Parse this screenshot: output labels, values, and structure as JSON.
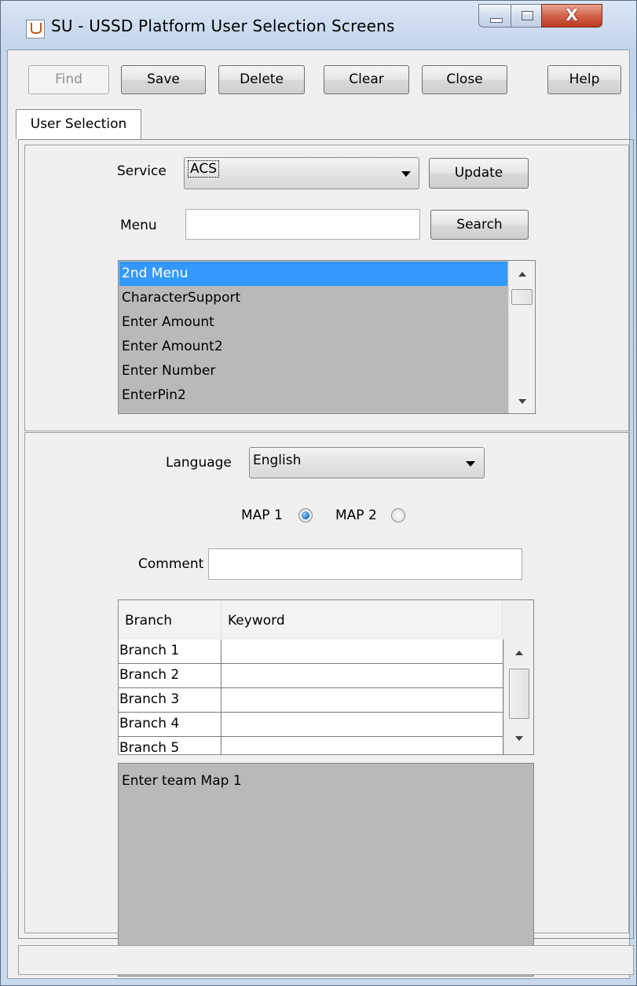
{
  "window": {
    "title": "SU - USSD Platform User Selection Screens",
    "close_glyph": "X"
  },
  "toolbar": {
    "find_label": "Find",
    "save_label": "Save",
    "delete_label": "Delete",
    "clear_label": "Clear",
    "close_label": "Close",
    "help_label": "Help"
  },
  "tabs": [
    {
      "label": "User Selection",
      "active": true
    }
  ],
  "service": {
    "label": "Service",
    "selected": "ACS",
    "update_label": "Update"
  },
  "menu": {
    "label": "Menu",
    "value": "",
    "search_label": "Search",
    "items": [
      {
        "label": "2nd Menu",
        "selected": true
      },
      {
        "label": "CharacterSupport",
        "selected": false
      },
      {
        "label": "Enter Amount",
        "selected": false
      },
      {
        "label": "Enter Amount2",
        "selected": false
      },
      {
        "label": "Enter Number",
        "selected": false
      },
      {
        "label": "EnterPin2",
        "selected": false
      }
    ]
  },
  "language": {
    "label": "Language",
    "selected": "English"
  },
  "map_options": [
    {
      "label": "MAP 1",
      "checked": true
    },
    {
      "label": "MAP 2",
      "checked": false
    }
  ],
  "comment": {
    "label": "Comment",
    "value": ""
  },
  "branch_table": {
    "columns": [
      "Branch",
      "Keyword"
    ],
    "rows": [
      {
        "branch": "Branch 1",
        "keyword": ""
      },
      {
        "branch": "Branch 2",
        "keyword": ""
      },
      {
        "branch": "Branch 3",
        "keyword": ""
      },
      {
        "branch": "Branch 4",
        "keyword": ""
      },
      {
        "branch": "Branch 5",
        "keyword": ""
      }
    ]
  },
  "preview": {
    "text": "Enter team Map 1"
  },
  "status_bar": {
    "text": ""
  },
  "colors": {
    "selection": "#3399ff",
    "list_background": "#b9b9b9",
    "radio_checked": "#1a6fc2",
    "close_button": "#d2634a"
  }
}
